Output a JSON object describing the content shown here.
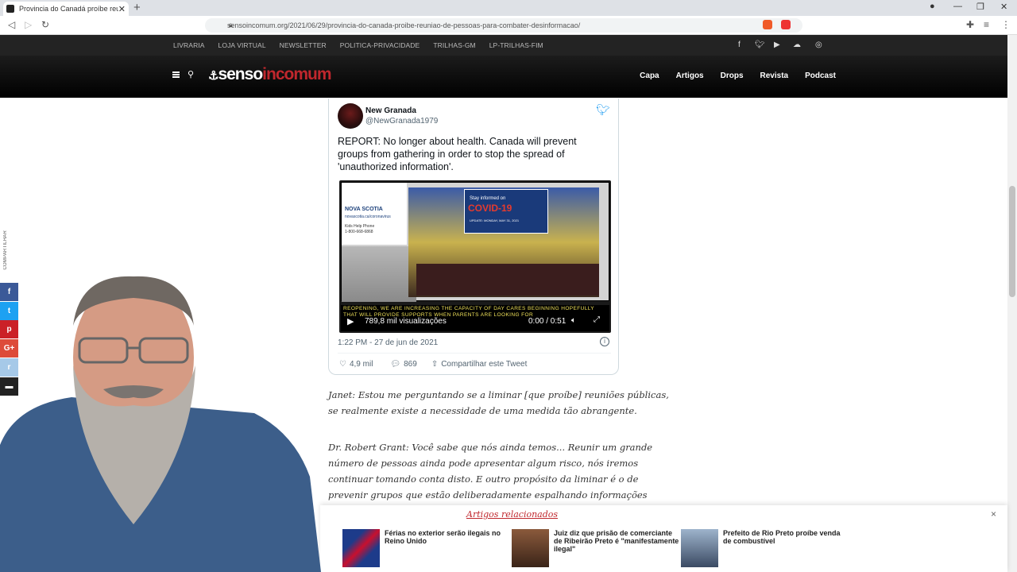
{
  "browser": {
    "tab_title": "Provincia do Canadá proíbe reuni",
    "url": "sensoincomum.org/2021/06/29/provincia-do-canada-proibe-reuniao-de-pessoas-para-combater-desinformacao/"
  },
  "site": {
    "top_links": [
      "LIVRARIA",
      "LOJA VIRTUAL",
      "NEWSLETTER",
      "POLITICA-PRIVACIDADE",
      "TRILHAS-GM",
      "LP-TRILHAS-FIM"
    ],
    "logo_part1": "senso",
    "logo_part2": "incomum",
    "main_nav": [
      "Capa",
      "Artigos",
      "Drops",
      "Revista",
      "Podcast"
    ],
    "share_label": "COMPARTILHAR"
  },
  "tweet": {
    "name": "New Granada",
    "handle": "@NewGranada1979",
    "text": "REPORT: No longer about health. Canada will prevent groups from gathering in order to stop the spread of 'unauthorized information'.",
    "video": {
      "caption": "REOPENING, WE ARE INCREASING THE CAPACITY OF DAY CARES BEGINNING HOPEFULLY THAT WILL PROVIDE SUPPORTS WHEN PARENTS ARE LOOKING FOR",
      "views": "789,8 mil visualizações",
      "time": "0:00 / 0:51",
      "ns_name": "NOVA SCOTIA",
      "ns_url": "novascotia.ca/coronavirus",
      "ns_help": "Kids Help Phone",
      "ns_phone": "1-800-668-6868",
      "covid_line1": "Stay informed on",
      "covid_line2": "COVID-19",
      "covid_line3": "UPDATE: MONDAY, MAY 31, 2021"
    },
    "date": "1:22 PM - 27 de jun de 2021",
    "likes": "4,9 mil",
    "replies": "869",
    "share": "Compartilhar este Tweet"
  },
  "article": {
    "para1": "Janet: Estou me perguntando se a liminar [que proíbe] reuniões públicas, se realmente existe a necessidade de uma medida tão abrangente.",
    "para2": "Dr. Robert Grant: Você sabe que nós ainda temos... Reunir um grande número de pessoas ainda pode apresentar algum risco, nós iremos continuar tomando conta disto. E outro propósito da liminar é o de prevenir grupos que estão deliberadamente espalhando informações falsas que criam riscos. As informações, se levadas a sério,"
  },
  "related": {
    "title": "Artigos relacionados",
    "items": [
      {
        "text": "Férias no exterior serão ilegais no Reino Unido"
      },
      {
        "text": "Juiz diz que prisão de comerciante de Ribeirão Preto é \"manifestamente ilegal\""
      },
      {
        "text": "Prefeito de Rio Preto proíbe venda de combustível"
      }
    ]
  },
  "colors": {
    "brand_red": "#c0272d",
    "twitter_blue": "#1d9bf0",
    "header_black": "#000000"
  }
}
